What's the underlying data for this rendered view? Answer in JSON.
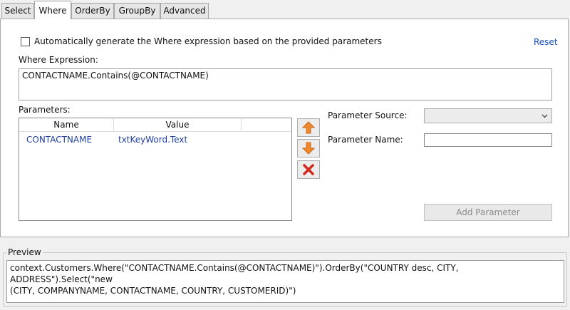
{
  "tabs": [
    {
      "label": "Select"
    },
    {
      "label": "Where"
    },
    {
      "label": "OrderBy"
    },
    {
      "label": "GroupBy"
    },
    {
      "label": "Advanced"
    }
  ],
  "active_tab": "Where",
  "where": {
    "auto_generate_label": "Automatically generate the Where expression based on the provided parameters",
    "auto_generate_checked": false,
    "reset_label": "Reset",
    "expression_label": "Where Expression:",
    "expression_value": "CONTACTNAME.Contains(@CONTACTNAME)",
    "parameters_label": "Parameters:",
    "columns": [
      "Name",
      "Value"
    ],
    "rows": [
      {
        "name": "CONTACTNAME",
        "value": "txtKeyWord.Text"
      }
    ],
    "parameter_source_label": "Parameter Source:",
    "parameter_source_value": "",
    "parameter_name_label": "Parameter Name:",
    "parameter_name_value": "",
    "add_parameter_label": "Add Parameter"
  },
  "preview": {
    "label": "Preview",
    "text": "context.Customers.Where(\"CONTACTNAME.Contains(@CONTACTNAME)\").OrderBy(\"COUNTRY desc, CITY, ADDRESS\").Select(\"new\n(CITY, COMPANYNAME, CONTACTNAME, COUNTRY, CUSTOMERID)\")"
  },
  "colors": {
    "accent_link": "#1a4fc0",
    "arrow_orange": "#f0892b",
    "delete_red": "#d42a1e"
  },
  "icons": [
    "move-up-arrow-icon",
    "move-down-arrow-icon",
    "delete-x-icon",
    "chevron-down-icon"
  ]
}
